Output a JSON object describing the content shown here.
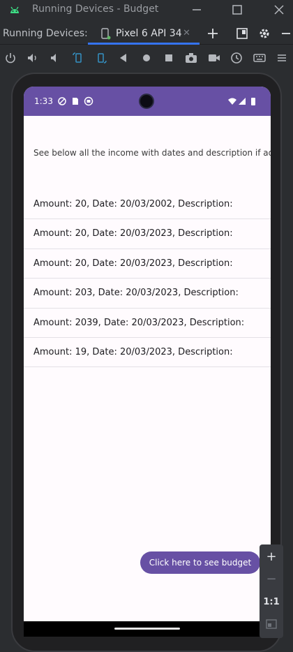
{
  "window": {
    "title": "Running Devices - Budget",
    "accent": "#3574f0"
  },
  "tabs": {
    "panel_label": "Running Devices:",
    "device_tab_label": "Pixel 6 API 34",
    "close_glyph": "✕"
  },
  "toolbar": {
    "icons": [
      "power-icon",
      "volume-up-icon",
      "volume-down-icon",
      "rotate-left-icon",
      "rotate-right-icon",
      "back-icon",
      "home-icon",
      "overview-icon",
      "camera-icon",
      "record-icon",
      "history-icon",
      "keyboard-icon"
    ]
  },
  "device": {
    "status_time": "1:33",
    "status_color": "#6750a4",
    "screen": {
      "header_text": "See below all the income with dates and description if added",
      "incomes": [
        "Amount: 20, Date: 20/03/2002, Description:",
        "Amount: 20, Date: 20/03/2023, Description:",
        "Amount: 20, Date: 20/03/2023, Description:",
        "Amount: 203, Date: 20/03/2023, Description:",
        "Amount: 2039, Date: 20/03/2023, Description:",
        "Amount: 19, Date: 20/03/2023, Description:"
      ],
      "budget_button_label": "Click here to see budget"
    }
  },
  "zoom": {
    "zoom_in": "+",
    "zoom_out": "−",
    "actual_size": "1:1"
  }
}
